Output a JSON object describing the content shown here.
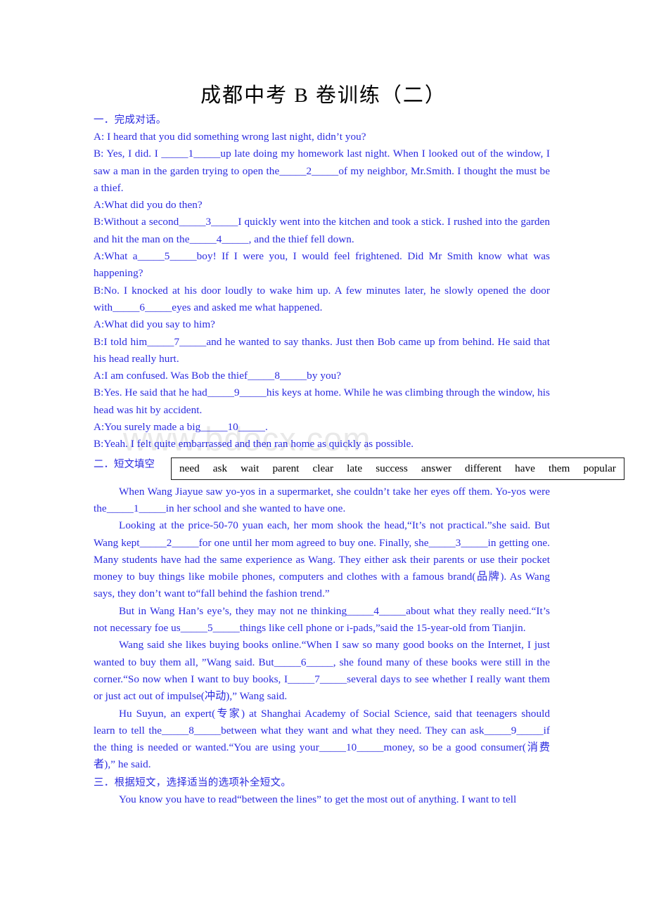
{
  "document": {
    "title": "成都中考 B 卷训练（二）",
    "watermark": "www.bdocx.com"
  },
  "section1": {
    "heading": "一．完成对话。",
    "lines": [
      "A: I heard that you did something wrong last night, didn’t you?",
      "B: Yes, I did. I _____1_____up late doing my homework last night. When I looked out of the window, I saw a man in the garden trying to open the_____2_____of my neighbor, Mr.Smith. I thought the must be a thief.",
      "A:What did you do then?",
      "B:Without a second_____3_____I quickly went into the kitchen and took a stick. I rushed into the garden and hit the man on the_____4_____, and the thief fell down.",
      "A:What a_____5_____boy! If I were you, I would feel frightened. Did Mr Smith know what was happening?",
      "B:No. I knocked at his door loudly to wake him up. A few minutes later, he slowly opened the door with_____6_____eyes and asked me what happened.",
      "A:What did you say to him?",
      "B:I told him_____7_____and he wanted to say thanks. Just then Bob came up from behind. He said that his head really hurt.",
      "A:I am confused. Was Bob the thief_____8_____by you?",
      "B:Yes. He said that he had_____9_____his keys at home. While he was climbing through the window, his head was hit by accident.",
      "A:You surely made a big_____10_____.",
      "B:Yeah. I felt quite embarrassed and then ran home as quickly as possible."
    ]
  },
  "section2": {
    "heading": "二．短文填空",
    "wordbank": [
      "need",
      "ask",
      "wait",
      "parent",
      "clear",
      "late",
      "success",
      "answer",
      "different",
      "have",
      "them",
      "popular"
    ],
    "paragraphs": [
      "When Wang Jiayue saw yo-yos in a supermarket, she couldn’t take her eyes off them. Yo-yos were the_____1_____in her school and she wanted to have one.",
      "Looking at the price-50-70 yuan each, her mom shook the head,“It’s not practical.”she said. But Wang kept_____2_____for one until her mom agreed to buy one. Finally, she_____3_____in getting one. Many students have had the same experience as Wang. They either ask their parents or use their pocket money to buy things like mobile phones, computers and clothes with a famous brand(品牌). As Wang says, they don’t want to“fall behind the fashion trend.”",
      "But in Wang Han’s eye’s, they may not ne thinking_____4_____about what they really need.“It’s not necessary foe us_____5_____things like cell phone or i-pads,”said the 15-year-old from Tianjin.",
      "Wang said she likes buying books online.“When I saw so many good books on the Internet, I just wanted to buy them all, ”Wang said. But_____6_____, she found many of these books were still in the corner.“So now when I want to buy books, I_____7_____several days to see whether I really want them or just act out of impulse(冲动),” Wang said.",
      "Hu Suyun, an expert(专家) at Shanghai Academy of Social Science, said that teenagers should learn to tell the_____8_____between what they want and what they need. They can ask_____9_____if the thing is needed or wanted.“You are using your_____10_____money, so be a good consumer(消费者),” he said."
    ]
  },
  "section3": {
    "heading": "三．根据短文，选择适当的选项补全短文。",
    "paragraphs": [
      "You know you have to read“between the lines” to get the most out of anything. I want to tell"
    ]
  }
}
